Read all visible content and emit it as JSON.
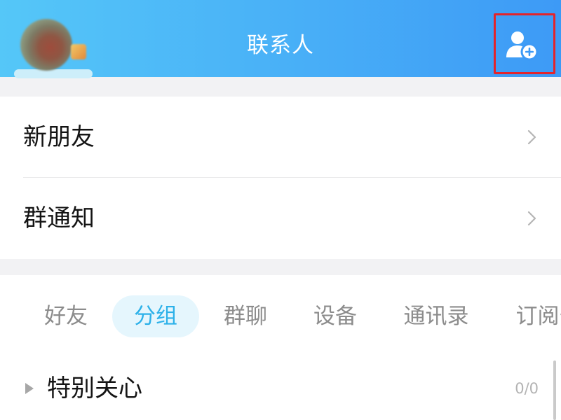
{
  "header": {
    "title": "联系人"
  },
  "icons": {
    "add_friend": "add-friend-icon",
    "row_chevron": "chevron-right-icon",
    "group_expand": "triangle-right-icon"
  },
  "colors": {
    "header_gradient_start": "#55c7f8",
    "header_gradient_end": "#3d9af6",
    "active_tab_text": "#2cb1e9",
    "active_tab_background": "#e5f6fd",
    "highlight_box": "#e3242b"
  },
  "menu": {
    "items": [
      {
        "label": "新朋友"
      },
      {
        "label": "群通知"
      }
    ]
  },
  "tabs": [
    {
      "label": "好友",
      "active": false
    },
    {
      "label": "分组",
      "active": true
    },
    {
      "label": "群聊",
      "active": false
    },
    {
      "label": "设备",
      "active": false
    },
    {
      "label": "通讯录",
      "active": false
    },
    {
      "label": "订阅号",
      "active": false
    }
  ],
  "groups": [
    {
      "name": "特别关心",
      "count": "0/0",
      "expanded": false
    }
  ]
}
